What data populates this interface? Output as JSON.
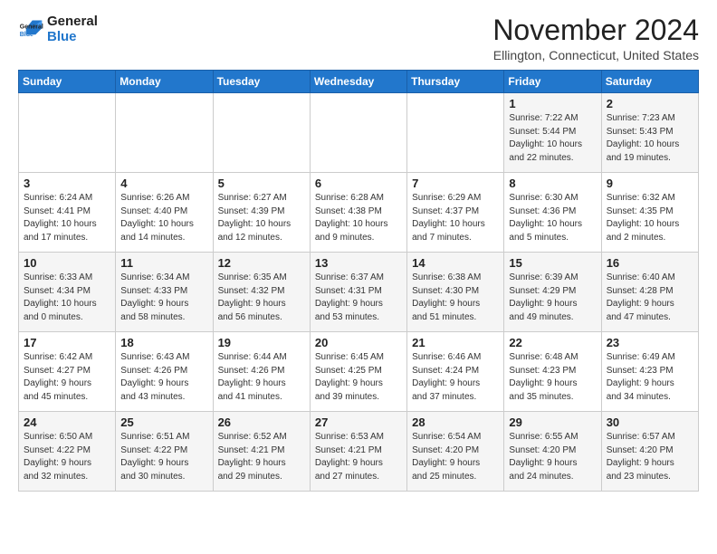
{
  "logo": {
    "line1": "General",
    "line2": "Blue"
  },
  "title": "November 2024",
  "location": "Ellington, Connecticut, United States",
  "days_header": [
    "Sunday",
    "Monday",
    "Tuesday",
    "Wednesday",
    "Thursday",
    "Friday",
    "Saturday"
  ],
  "weeks": [
    [
      {
        "day": "",
        "info": ""
      },
      {
        "day": "",
        "info": ""
      },
      {
        "day": "",
        "info": ""
      },
      {
        "day": "",
        "info": ""
      },
      {
        "day": "",
        "info": ""
      },
      {
        "day": "1",
        "info": "Sunrise: 7:22 AM\nSunset: 5:44 PM\nDaylight: 10 hours\nand 22 minutes."
      },
      {
        "day": "2",
        "info": "Sunrise: 7:23 AM\nSunset: 5:43 PM\nDaylight: 10 hours\nand 19 minutes."
      }
    ],
    [
      {
        "day": "3",
        "info": "Sunrise: 6:24 AM\nSunset: 4:41 PM\nDaylight: 10 hours\nand 17 minutes."
      },
      {
        "day": "4",
        "info": "Sunrise: 6:26 AM\nSunset: 4:40 PM\nDaylight: 10 hours\nand 14 minutes."
      },
      {
        "day": "5",
        "info": "Sunrise: 6:27 AM\nSunset: 4:39 PM\nDaylight: 10 hours\nand 12 minutes."
      },
      {
        "day": "6",
        "info": "Sunrise: 6:28 AM\nSunset: 4:38 PM\nDaylight: 10 hours\nand 9 minutes."
      },
      {
        "day": "7",
        "info": "Sunrise: 6:29 AM\nSunset: 4:37 PM\nDaylight: 10 hours\nand 7 minutes."
      },
      {
        "day": "8",
        "info": "Sunrise: 6:30 AM\nSunset: 4:36 PM\nDaylight: 10 hours\nand 5 minutes."
      },
      {
        "day": "9",
        "info": "Sunrise: 6:32 AM\nSunset: 4:35 PM\nDaylight: 10 hours\nand 2 minutes."
      }
    ],
    [
      {
        "day": "10",
        "info": "Sunrise: 6:33 AM\nSunset: 4:34 PM\nDaylight: 10 hours\nand 0 minutes."
      },
      {
        "day": "11",
        "info": "Sunrise: 6:34 AM\nSunset: 4:33 PM\nDaylight: 9 hours\nand 58 minutes."
      },
      {
        "day": "12",
        "info": "Sunrise: 6:35 AM\nSunset: 4:32 PM\nDaylight: 9 hours\nand 56 minutes."
      },
      {
        "day": "13",
        "info": "Sunrise: 6:37 AM\nSunset: 4:31 PM\nDaylight: 9 hours\nand 53 minutes."
      },
      {
        "day": "14",
        "info": "Sunrise: 6:38 AM\nSunset: 4:30 PM\nDaylight: 9 hours\nand 51 minutes."
      },
      {
        "day": "15",
        "info": "Sunrise: 6:39 AM\nSunset: 4:29 PM\nDaylight: 9 hours\nand 49 minutes."
      },
      {
        "day": "16",
        "info": "Sunrise: 6:40 AM\nSunset: 4:28 PM\nDaylight: 9 hours\nand 47 minutes."
      }
    ],
    [
      {
        "day": "17",
        "info": "Sunrise: 6:42 AM\nSunset: 4:27 PM\nDaylight: 9 hours\nand 45 minutes."
      },
      {
        "day": "18",
        "info": "Sunrise: 6:43 AM\nSunset: 4:26 PM\nDaylight: 9 hours\nand 43 minutes."
      },
      {
        "day": "19",
        "info": "Sunrise: 6:44 AM\nSunset: 4:26 PM\nDaylight: 9 hours\nand 41 minutes."
      },
      {
        "day": "20",
        "info": "Sunrise: 6:45 AM\nSunset: 4:25 PM\nDaylight: 9 hours\nand 39 minutes."
      },
      {
        "day": "21",
        "info": "Sunrise: 6:46 AM\nSunset: 4:24 PM\nDaylight: 9 hours\nand 37 minutes."
      },
      {
        "day": "22",
        "info": "Sunrise: 6:48 AM\nSunset: 4:23 PM\nDaylight: 9 hours\nand 35 minutes."
      },
      {
        "day": "23",
        "info": "Sunrise: 6:49 AM\nSunset: 4:23 PM\nDaylight: 9 hours\nand 34 minutes."
      }
    ],
    [
      {
        "day": "24",
        "info": "Sunrise: 6:50 AM\nSunset: 4:22 PM\nDaylight: 9 hours\nand 32 minutes."
      },
      {
        "day": "25",
        "info": "Sunrise: 6:51 AM\nSunset: 4:22 PM\nDaylight: 9 hours\nand 30 minutes."
      },
      {
        "day": "26",
        "info": "Sunrise: 6:52 AM\nSunset: 4:21 PM\nDaylight: 9 hours\nand 29 minutes."
      },
      {
        "day": "27",
        "info": "Sunrise: 6:53 AM\nSunset: 4:21 PM\nDaylight: 9 hours\nand 27 minutes."
      },
      {
        "day": "28",
        "info": "Sunrise: 6:54 AM\nSunset: 4:20 PM\nDaylight: 9 hours\nand 25 minutes."
      },
      {
        "day": "29",
        "info": "Sunrise: 6:55 AM\nSunset: 4:20 PM\nDaylight: 9 hours\nand 24 minutes."
      },
      {
        "day": "30",
        "info": "Sunrise: 6:57 AM\nSunset: 4:20 PM\nDaylight: 9 hours\nand 23 minutes."
      }
    ]
  ]
}
